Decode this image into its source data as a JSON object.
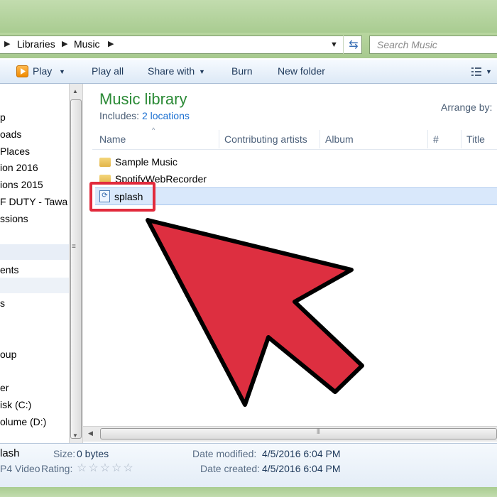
{
  "address": {
    "crumbs": [
      "Libraries",
      "Music"
    ],
    "search_placeholder": "Search Music"
  },
  "toolbar": {
    "play_label": "Play",
    "play_all_label": "Play all",
    "share_with_label": "Share with",
    "burn_label": "Burn",
    "new_folder_label": "New folder"
  },
  "sidebar": {
    "items": [
      "p",
      "oads",
      "Places",
      "ion 2016",
      "ions 2015",
      "F DUTY - Tawa",
      "ssions",
      "ents",
      "s",
      "oup",
      "er",
      "isk (C:)",
      "olume (D:)"
    ]
  },
  "library": {
    "title": "Music library",
    "includes_label": "Includes:",
    "locations_link": "2 locations",
    "arrange_label": "Arrange by:"
  },
  "columns": [
    "Name",
    "Contributing artists",
    "Album",
    "#",
    "Title"
  ],
  "files": [
    {
      "name": "Sample Music",
      "type": "folder"
    },
    {
      "name": "SpotifyWebRecorder",
      "type": "folder"
    },
    {
      "name": "splash",
      "type": "video",
      "selected": true
    }
  ],
  "details": {
    "name": "lash",
    "type": "P4 Video",
    "size_label": "Size:",
    "size_value": "0 bytes",
    "rating_label": "Rating:",
    "rating_stars": "☆☆☆☆☆",
    "modified_label": "Date modified:",
    "modified_value": "4/5/2016 6:04 PM",
    "created_label": "Date created:",
    "created_value": "4/5/2016 6:04 PM"
  },
  "colors": {
    "highlight_red": "#e22a3c",
    "arrow_red": "#dd2f40",
    "library_green": "#2b8a36"
  },
  "icons": [
    "play-icon",
    "views-icon",
    "refresh-icon",
    "folder-icon",
    "video-file-icon",
    "red-arrow-annotation"
  ]
}
